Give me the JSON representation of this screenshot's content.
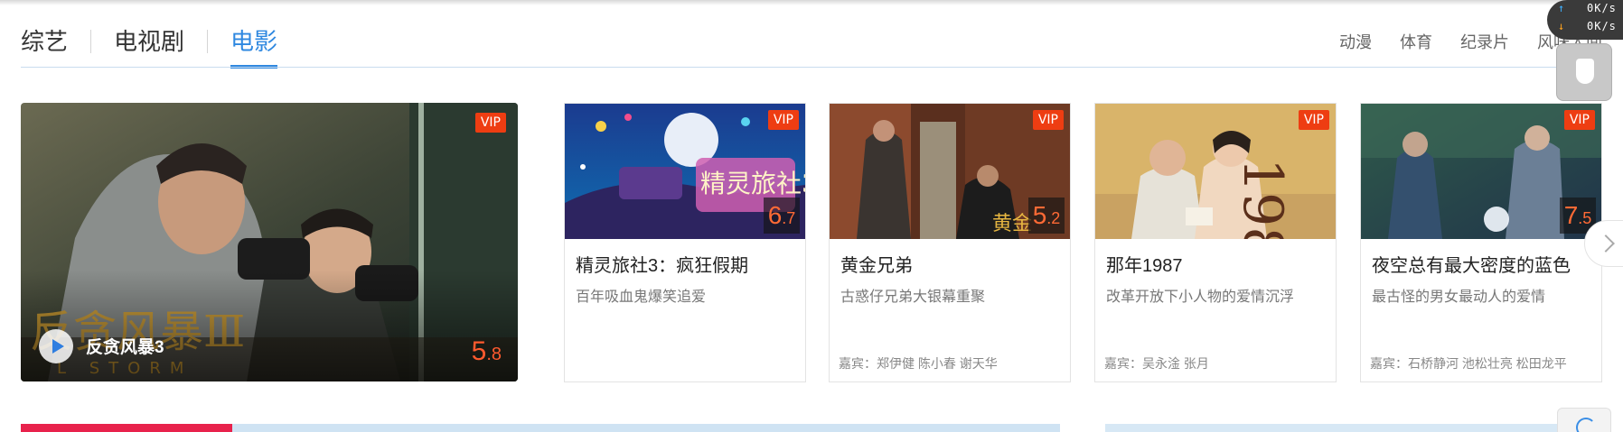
{
  "tabs": {
    "left": [
      {
        "label": "综艺",
        "active": false
      },
      {
        "label": "电视剧",
        "active": false
      },
      {
        "label": "电影",
        "active": true
      }
    ],
    "right": [
      "动漫",
      "体育",
      "纪录片",
      "风味人间"
    ]
  },
  "speed_widget": {
    "upload": "0K/s",
    "download": "0K/s"
  },
  "featured": {
    "title": "反贪风暴3",
    "badge": "VIP",
    "score_main": "5",
    "score_decimal": ".8"
  },
  "cards": [
    {
      "title": "精灵旅社3：疯狂假期",
      "desc": "百年吸血鬼爆笑追爱",
      "cast": "",
      "badge": "VIP",
      "score_main": "6",
      "score_decimal": ".7"
    },
    {
      "title": "黄金兄弟",
      "desc": "古惑仔兄弟大银幕重聚",
      "cast": "嘉宾：郑伊健 陈小春 谢天华",
      "badge": "VIP",
      "score_main": "5",
      "score_decimal": ".2"
    },
    {
      "title": "那年1987",
      "desc": "改革开放下小人物的爱情沉浮",
      "cast": "嘉宾：吴永淦 张月",
      "badge": "VIP",
      "score_main": "",
      "score_decimal": ""
    },
    {
      "title": "夜空总有最大密度的蓝色",
      "desc": "最古怪的男女最动人的爱情",
      "cast": "嘉宾：石桥静河 池松壮亮 松田龙平",
      "badge": "VIP",
      "score_main": "7",
      "score_decimal": ".5"
    }
  ],
  "colors": {
    "accent": "#2f88e0",
    "vip": "#ee3d12",
    "score": "#ff5a2e"
  }
}
